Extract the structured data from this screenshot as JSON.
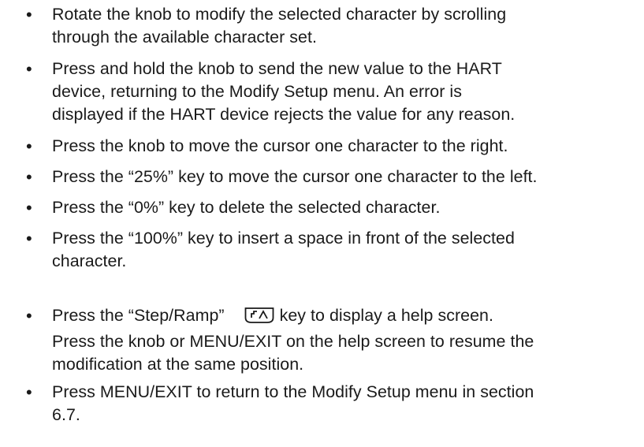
{
  "bullet_symbol": "•",
  "items": [
    {
      "lines": [
        "Rotate the knob to modify the selected character by scrolling",
        "through the available character set."
      ]
    },
    {
      "lines": [
        "Press and hold the knob to send the new value to the HART",
        "device, returning to the Modify Setup menu.  An error is",
        "displayed if the HART device rejects the value for any reason."
      ]
    },
    {
      "lines": [
        "Press the knob to move the cursor one character to the right."
      ]
    },
    {
      "lines": [
        "Press the “25%” key to move the cursor one character to the left."
      ]
    },
    {
      "lines": [
        "Press the “0%” key to delete the selected character."
      ]
    },
    {
      "lines": [
        "Press the “100%” key to insert a space in front of the selected",
        "character."
      ]
    },
    {
      "line1_before_icon": "Press the “Step/Ramp”",
      "icon": "step-ramp-key-icon",
      "line1_after_icon": "key to display a help screen.",
      "lines": [
        "Press the knob or MENU/EXIT on the help screen to resume the",
        "modification at the same position."
      ]
    },
    {
      "lines": [
        "Press MENU/EXIT to return to the Modify Setup menu in section",
        "6.7."
      ]
    }
  ]
}
